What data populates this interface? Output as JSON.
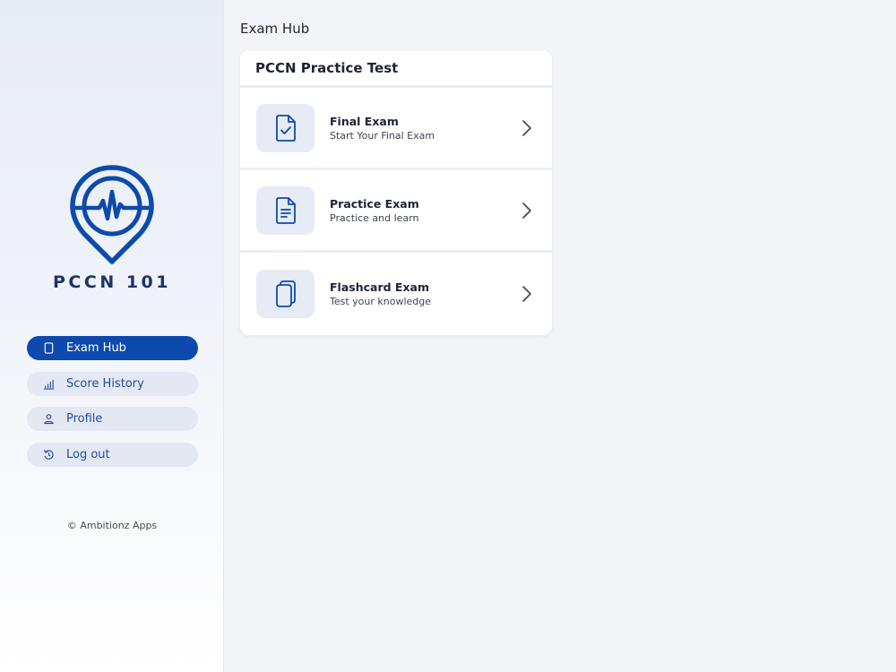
{
  "sidebar": {
    "brand": "PCCN 101",
    "logo_icon": "heart-pulse-location-pin-icon",
    "nav": [
      {
        "label": "Exam Hub",
        "icon": "tablet-icon",
        "active": true
      },
      {
        "label": "Score History",
        "icon": "bar-chart-icon",
        "active": false
      },
      {
        "label": "Profile",
        "icon": "user-icon",
        "active": false
      },
      {
        "label": "Log out",
        "icon": "logout-icon",
        "active": false
      }
    ],
    "copyright": "© Ambitionz Apps"
  },
  "main": {
    "title": "Exam Hub",
    "card": {
      "title": "PCCN Practice Test",
      "exams": [
        {
          "title": "Final Exam",
          "subtitle": "Start Your Final Exam",
          "icon": "document-check-icon"
        },
        {
          "title": "Practice Exam",
          "subtitle": "Practice and learn",
          "icon": "document-lines-icon"
        },
        {
          "title": "Flashcard Exam",
          "subtitle": "Test your knowledge",
          "icon": "flashcards-icon"
        }
      ]
    }
  },
  "colors": {
    "accent": "#0c4aad",
    "brand_text": "#1d3466",
    "nav_bg": "#e3e8f3",
    "icon_bg": "#e6ebf5",
    "page_bg": "#f3f4f7"
  }
}
